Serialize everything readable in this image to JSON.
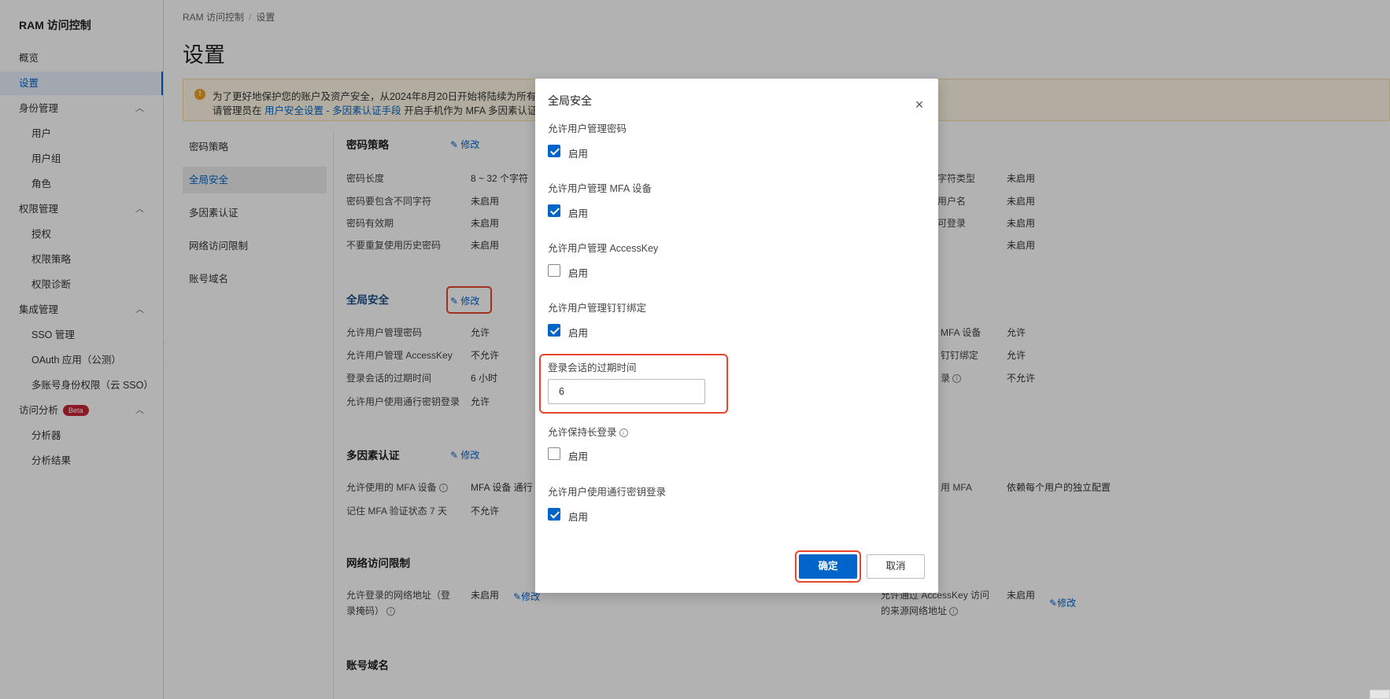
{
  "sidebar": {
    "title": "RAM 访问控制",
    "items": [
      {
        "label": "概览"
      },
      {
        "label": "设置"
      },
      {
        "label": "身份管理"
      },
      {
        "label": "用户"
      },
      {
        "label": "用户组"
      },
      {
        "label": "角色"
      },
      {
        "label": "权限管理"
      },
      {
        "label": "授权"
      },
      {
        "label": "权限策略"
      },
      {
        "label": "权限诊断"
      },
      {
        "label": "集成管理"
      },
      {
        "label": "SSO 管理"
      },
      {
        "label": "OAuth 应用（公测）"
      },
      {
        "label": "多账号身份权限（云 SSO）"
      },
      {
        "label": "访问分析"
      },
      {
        "label": "分析器"
      },
      {
        "label": "分析结果"
      }
    ],
    "beta_badge": "Beta",
    "collapse_glyph": "‹"
  },
  "breadcrumb": {
    "root": "RAM 访问控制",
    "sep": "/",
    "current": "设置"
  },
  "page_title": "设置",
  "banner": {
    "line1": "为了更好地保护您的账户及资产安全，从2024年8月20日开始将陆续为所有用户",
    "line2_prefix": "请管理员在",
    "line2_link": "用户安全设置 - 多因素认证手段",
    "line2_suffix": "开启手机作为 MFA 多因素认证方式"
  },
  "subnav": {
    "items": [
      {
        "label": "密码策略"
      },
      {
        "label": "全局安全"
      },
      {
        "label": "多因素认证"
      },
      {
        "label": "网络访问限制"
      },
      {
        "label": "账号域名"
      }
    ]
  },
  "edit_label": "修改",
  "password_policy": {
    "title": "密码策略",
    "rows": [
      {
        "label": "密码长度",
        "value": "8 ~ 32 个字符"
      },
      {
        "label": "密码要包含不同字符",
        "value": "未启用"
      },
      {
        "label": "密码有效期",
        "value": "未启用"
      },
      {
        "label": "不要重复使用历史密码",
        "value": "未启用"
      }
    ],
    "right_rows": [
      {
        "label": "字符类型",
        "value": "未启用"
      },
      {
        "label": "用户名",
        "value": "未启用"
      },
      {
        "label": "可登录",
        "value": "未启用"
      },
      {
        "label": "",
        "value": "未启用"
      }
    ]
  },
  "global_security": {
    "title": "全局安全",
    "rows": [
      {
        "label": "允许用户管理密码",
        "value": "允许"
      },
      {
        "label": "允许用户管理 AccessKey",
        "value": "不允许"
      },
      {
        "label": "登录会话的过期时间",
        "value": "6 小时"
      },
      {
        "label": "允许用户使用通行密钥登录",
        "value": "允许"
      }
    ],
    "right_rows": [
      {
        "label": "MFA 设备",
        "value": "允许"
      },
      {
        "label": "钉钉绑定",
        "value": "允许"
      },
      {
        "label": "录",
        "value": "不允许"
      }
    ]
  },
  "mfa": {
    "title": "多因素认证",
    "rows": [
      {
        "label": "允许使用的 MFA 设备",
        "value": "MFA 设备  通行"
      },
      {
        "label": "记住 MFA 验证状态 7 天",
        "value": "不允许"
      }
    ],
    "right_label": "用 MFA",
    "right_value": "依赖每个用户的独立配置"
  },
  "network": {
    "title": "网络访问限制",
    "left_label_1": "允许登录的网络地址（登",
    "left_label_2": "录掩码）",
    "left_value": "未启用",
    "right_label_1": "允许通过 AccessKey 访问",
    "right_label_2": "的来源网络地址",
    "right_value": "未启用"
  },
  "account_domain": {
    "title": "账号域名"
  },
  "modal": {
    "title": "全局安全",
    "close": "×",
    "enable_label": "启用",
    "fields": [
      {
        "label": "允许用户管理密码",
        "checked": true
      },
      {
        "label": "允许用户管理 MFA 设备",
        "checked": true
      },
      {
        "label": "允许用户管理 AccessKey",
        "checked": false
      },
      {
        "label": "允许用户管理钉钉绑定",
        "checked": true
      },
      {
        "label": "允许保持长登录",
        "checked": false
      },
      {
        "label": "允许用户使用通行密钥登录",
        "checked": true
      }
    ],
    "session_label": "登录会话的过期时间",
    "session_value": "6",
    "ok": "确定",
    "cancel": "取消"
  }
}
